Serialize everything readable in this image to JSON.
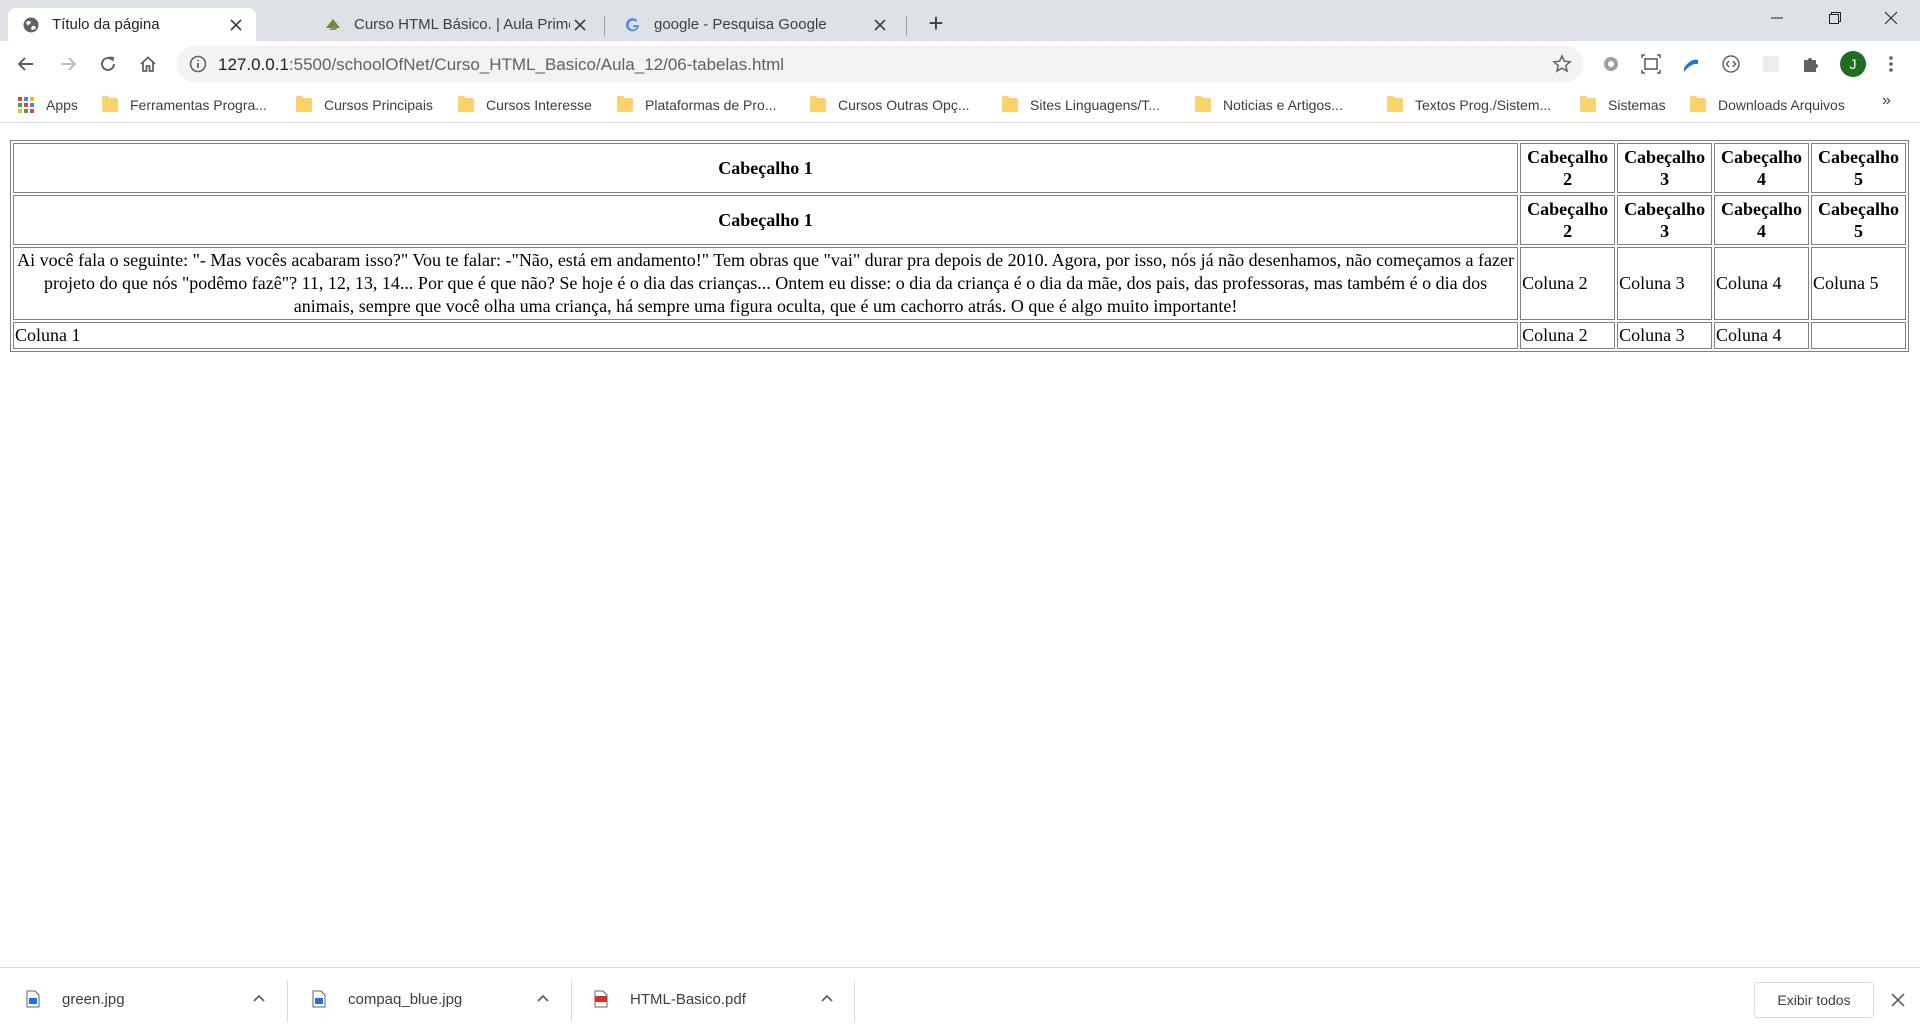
{
  "browser": {
    "tabs": [
      {
        "label": "Título da página",
        "icon": "globe-icon",
        "active": true
      },
      {
        "label": "Curso HTML Básico. | Aula Primeira",
        "icon": "course-icon",
        "active": false
      },
      {
        "label": "google - Pesquisa Google",
        "icon": "google-icon",
        "active": false
      }
    ],
    "new_tab_label": "+",
    "url_host": "127.0.0.1",
    "url_rest": ":5500/schoolOfNet/Curso_HTML_Basico/Aula_12/06-tabelas.html",
    "avatar_letter": "J"
  },
  "bookmarks": {
    "apps_label": "Apps",
    "items": [
      "Ferramentas Progra...",
      "Cursos Principais",
      "Cursos Interesse",
      "Plataformas de Pro...",
      "Cursos Outras Opç...",
      "Sites Linguagens/T...",
      "Noticias e Artigos...",
      "Textos Prog./Sistem...",
      "Sistemas",
      "Downloads Arquivos"
    ],
    "more_label": "»"
  },
  "table": {
    "header_row_1": [
      "Cabeçalho 1",
      "Cabeçalho 2",
      "Cabeçalho 3",
      "Cabeçalho 4",
      "Cabeçalho 5"
    ],
    "header_row_2": [
      "Cabeçalho 1",
      "Cabeçalho 2",
      "Cabeçalho 3",
      "Cabeçalho 4",
      "Cabeçalho 5"
    ],
    "row_1": {
      "paragraph": "Ai você fala o seguinte: \"- Mas vocês acabaram isso?\" Vou te falar: -\"Não, está em andamento!\" Tem obras que \"vai\" durar pra depois de 2010. Agora, por isso, nós já não desenhamos, não começamos a fazer projeto do que nós \"podêmo fazê\"? 11, 12, 13, 14... Por que é que não? Se hoje é o dia das crianças... Ontem eu disse: o dia da criança é o dia da mãe, dos pais, das professoras, mas também é o dia dos animais, sempre que você olha uma criança, há sempre uma figura oculta, que é um cachorro atrás. O que é algo muito importante!",
      "cells": [
        "Coluna 2",
        "Coluna 3",
        "Coluna 4",
        "Coluna 5"
      ]
    },
    "row_2": [
      "Coluna 1",
      "Coluna 2",
      "Coluna 3",
      "Coluna 4",
      ""
    ]
  },
  "downloads": {
    "items": [
      {
        "name": "green.jpg",
        "icon": "image-file-icon"
      },
      {
        "name": "compaq_blue.jpg",
        "icon": "image-file-icon"
      },
      {
        "name": "HTML-Basico.pdf",
        "icon": "pdf-file-icon"
      }
    ],
    "show_all_label": "Exibir todos"
  },
  "colors": {
    "tabstrip_bg": "#dee1e6",
    "omnibox_bg": "#f1f3f4",
    "folder_yellow": "#fcd36a",
    "avatar_green": "#1e6e22"
  }
}
